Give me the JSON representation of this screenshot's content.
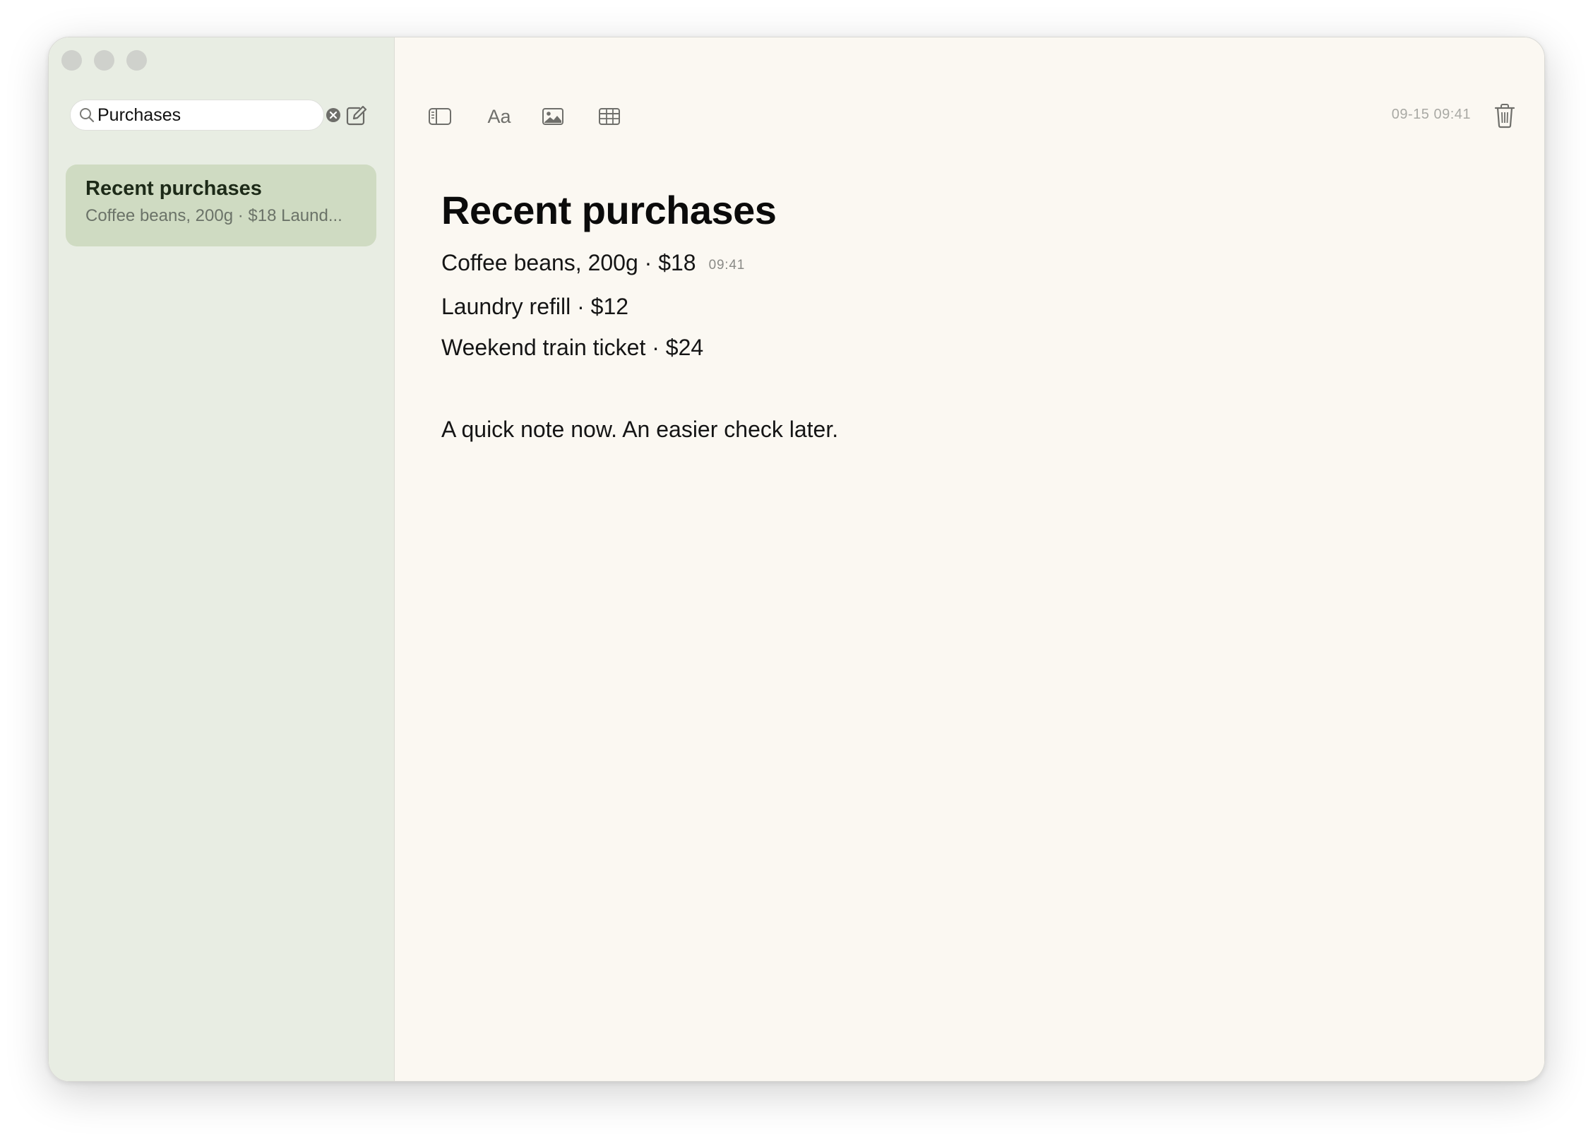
{
  "window": {
    "controls": [
      "close",
      "minimize",
      "zoom"
    ]
  },
  "sidebar": {
    "search": {
      "value": "Purchases",
      "placeholder": "Search"
    },
    "notes": [
      {
        "title": "Recent purchases",
        "preview": "Coffee beans, 200g · $18 Laund..."
      }
    ]
  },
  "toolbar": {
    "format_label": "Aa",
    "timestamp": "09-15 09:41"
  },
  "note": {
    "title": "Recent purchases",
    "lines": [
      {
        "text": "Coffee beans, 200g · $18",
        "time": "09:41"
      },
      {
        "text": "Laundry refill · $12"
      },
      {
        "text": "Weekend train ticket · $24"
      }
    ],
    "footer": "A quick note now. An easier check later."
  },
  "colors": {
    "sidebar_bg": "#e8ede3",
    "selected_note_bg": "#cfdbc2",
    "editor_bg": "#fbf8f2"
  }
}
